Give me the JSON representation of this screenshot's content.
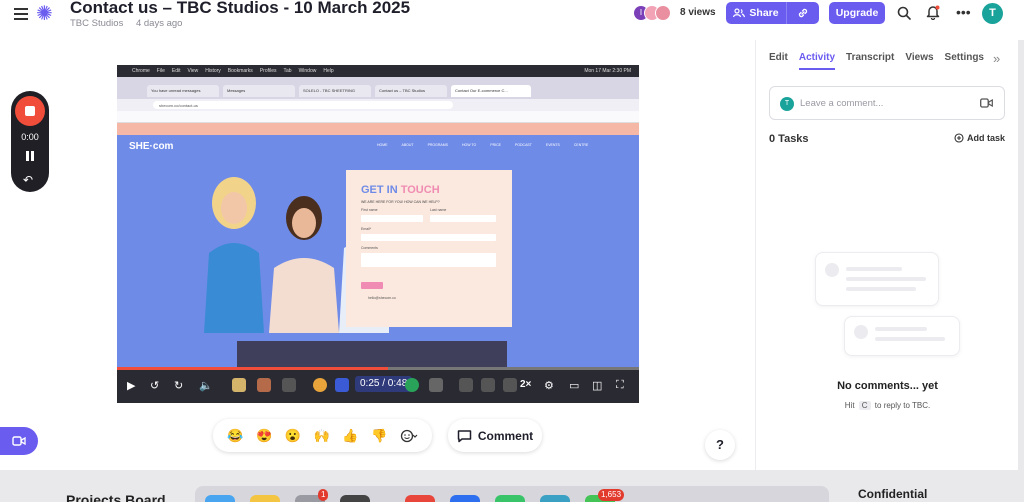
{
  "header": {
    "title": "Contact us – TBC Studios - 10 March 2025",
    "owner": "TBC Studios",
    "time_ago": "4 days ago",
    "views_label": "8 views",
    "viewer_initial": "I",
    "share_label": "Share",
    "upgrade_label": "Upgrade",
    "user_initial": "T"
  },
  "recorder": {
    "time": "0:00"
  },
  "video": {
    "mac_menu": [
      "Chrome",
      "File",
      "Edit",
      "View",
      "History",
      "Bookmarks",
      "Profiles",
      "Tab",
      "Window",
      "Help"
    ],
    "clock": "Mon 17 Mar 2:30 PM",
    "tabs": [
      "You have unread messages",
      "Messages",
      "SOLELO - TBC SHEETRING",
      "Contact us – TBC Studios",
      "Contact Our E-commerce C..."
    ],
    "url": "shecom.co/contact-us",
    "site_logo": "SHE·com",
    "site_nav": [
      "HOME",
      "ABOUT",
      "PROGRAMS",
      "HOW TO",
      "PRICE",
      "PODCAST",
      "EVENTS",
      "CENTRE"
    ],
    "card_title_a": "GET IN",
    "card_title_b": "TOUCH",
    "card_sub": "WE ARE HERE FOR YOU! HOW CAN WE HELP?",
    "field_first": "First name",
    "field_last": "Last name",
    "field_email": "Email*",
    "field_comments": "Comments",
    "card_email": "hello@shecom.co",
    "timecode": "0:25 / 0:48",
    "speed": "2×",
    "progress": 0.52
  },
  "reactions": [
    "😂",
    "😍",
    "😮",
    "🙌",
    "👍",
    "👎"
  ],
  "comment_label": "Comment",
  "help_label": "?",
  "panel": {
    "tabs": [
      "Edit",
      "Activity",
      "Transcript",
      "Views",
      "Settings"
    ],
    "active_tab": "Activity",
    "comment_placeholder": "Leave a comment...",
    "commenter_initial": "T",
    "tasks_label": "0 Tasks",
    "add_task_label": "Add task",
    "empty_title": "No comments... yet",
    "hint_pre": "Hit",
    "hint_key": "C",
    "hint_post": "to reply to TBC."
  },
  "desktop": {
    "left_text": "Projects Board",
    "right_text": "Confidential",
    "badge_1": "1",
    "badge_2": "1,653"
  },
  "colors": {
    "accent": "#6b5cf0",
    "record_red": "#f04d3a",
    "avatar_teal": "#1aa39a"
  }
}
